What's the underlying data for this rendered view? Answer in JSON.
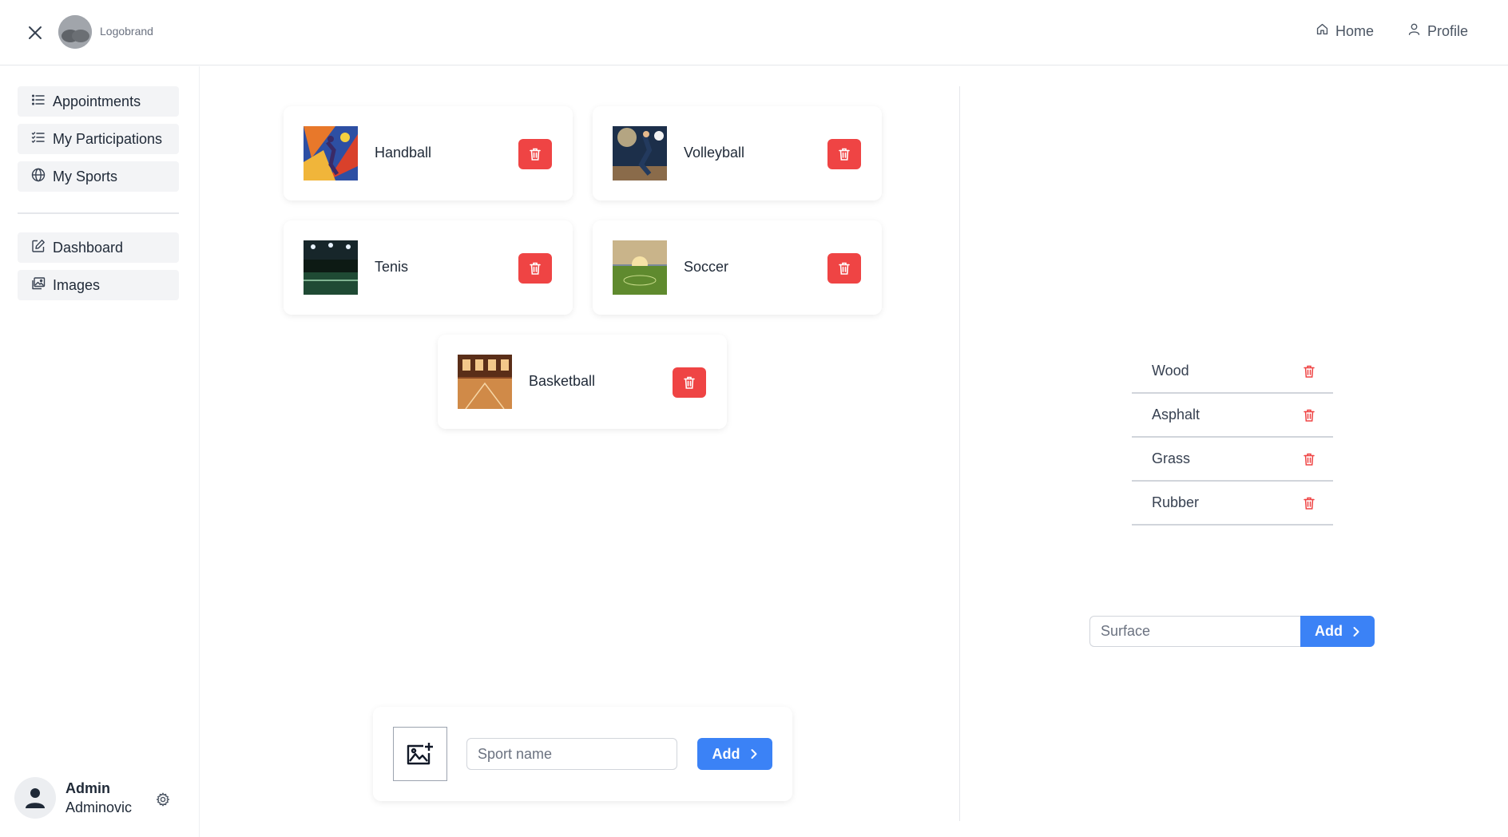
{
  "header": {
    "brand": "Logobrand",
    "nav": [
      {
        "label": "Home",
        "icon": "home-icon"
      },
      {
        "label": "Profile",
        "icon": "user-icon"
      }
    ]
  },
  "sidebar": {
    "items": [
      {
        "label": "Appointments",
        "icon": "list-icon"
      },
      {
        "label": "My Participations",
        "icon": "checklist-icon"
      },
      {
        "label": "My Sports",
        "icon": "globe-icon"
      },
      {
        "label": "Dashboard",
        "icon": "edit-icon"
      },
      {
        "label": "Images",
        "icon": "images-icon"
      }
    ],
    "user": {
      "first_name": "Admin",
      "last_name": "Adminovic"
    }
  },
  "sports": [
    {
      "name": "Handball"
    },
    {
      "name": "Volleyball"
    },
    {
      "name": "Tenis"
    },
    {
      "name": "Soccer"
    },
    {
      "name": "Basketball"
    }
  ],
  "add_sport": {
    "placeholder": "Sport name",
    "button_label": "Add"
  },
  "surfaces": [
    {
      "name": "Wood"
    },
    {
      "name": "Asphalt"
    },
    {
      "name": "Grass"
    },
    {
      "name": "Rubber"
    }
  ],
  "add_surface": {
    "placeholder": "Surface",
    "button_label": "Add"
  },
  "colors": {
    "danger": "#ef4444",
    "primary": "#3b82f6"
  }
}
